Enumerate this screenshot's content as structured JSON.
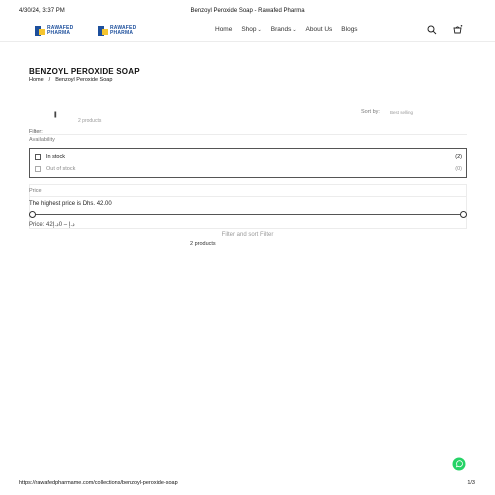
{
  "print_header": {
    "datetime": "4/30/24, 3:37 PM",
    "title": "Benzoyl Peroxide Soap - Rawafed Pharma"
  },
  "logos": [
    {
      "line1": "RAWAFED",
      "line2": "PHARMA"
    },
    {
      "line1": "RAWAFED",
      "line2": "PHARMA"
    }
  ],
  "nav": {
    "items": [
      "Home",
      "Shop",
      "Brands",
      "About Us",
      "Blogs"
    ],
    "dropdowns": [
      false,
      true,
      true,
      false,
      false
    ]
  },
  "page": {
    "title": "BENZOYL PEROXIDE SOAP",
    "breadcrumb": [
      "Home",
      "/",
      "Benzoyl Peroxide Soap"
    ]
  },
  "toolbar": {
    "grid_glyph": "|||",
    "products_count_top": "2 products",
    "sort_label": "Sort by:",
    "sort_value": "Best selling"
  },
  "filter": {
    "label": "Filter:",
    "availability_label": "Availability",
    "options": [
      {
        "label": "In stock",
        "count": "(2)"
      },
      {
        "label": "Out of stock",
        "count": "(0)"
      }
    ],
    "price": {
      "label": "Price",
      "highest": "The highest price is Dhs. 42.00",
      "value": "Price:  42د.إ – 0د.إ"
    },
    "filter_and_sort": "Filter and sort   Filter"
  },
  "results": {
    "products_count": "2 products"
  },
  "print_footer": {
    "url": "https://rawafedpharmame.com/collections/benzoyl-peroxide-soap",
    "page": "1/3"
  },
  "colors": {
    "brand_blue": "#1d4f9c",
    "brand_yellow": "#f4c430",
    "whatsapp_green": "#25d366"
  }
}
